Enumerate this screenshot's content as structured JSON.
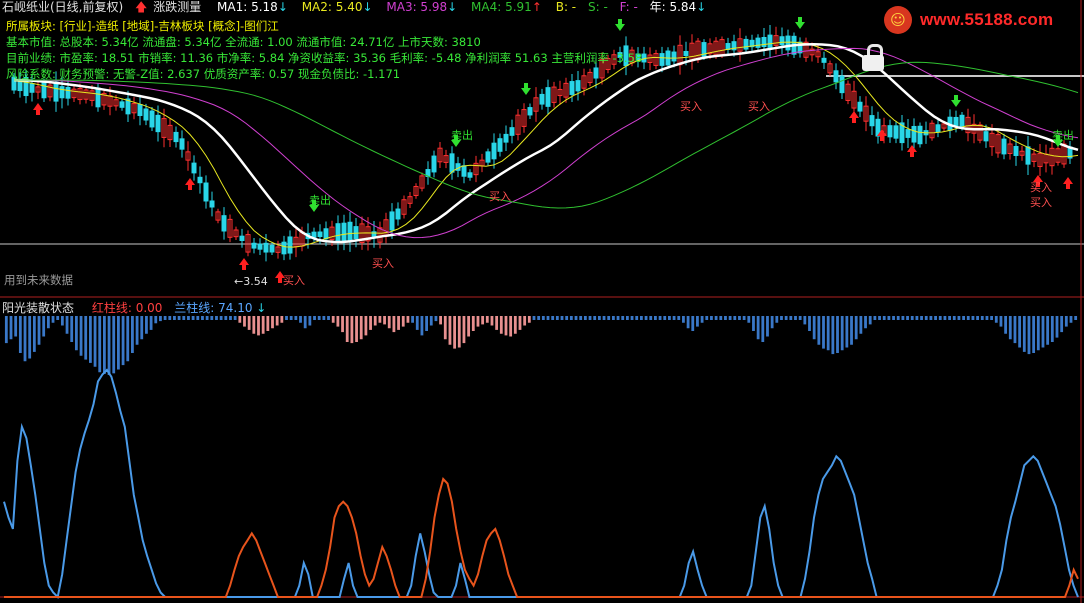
{
  "header": {
    "stock_name": "石岘纸业(日线,前复权)",
    "indicator_icon": "red-up-arrow-icon",
    "indicator_name": "涨跌测量",
    "ma1": "MA1: 5.18",
    "ma2": "MA2: 5.40",
    "ma3": "MA3: 5.98",
    "ma4": "MA4: 5.91",
    "b": "B: -",
    "s": "S: -",
    "f": "F: -",
    "year": "年: 5.84"
  },
  "info_lines": [
    "所属板块: [行业]-造纸 [地域]-吉林板块 [概念]-图们江",
    "基本市值: 总股本: 5.34亿 流通盘: 5.34亿 全流通: 1.00 流通市值: 24.71亿 上市天数: 3810",
    "目前业绩: 市盈率: 18.51 市销率: 11.36 市净率: 5.84 净资收益率: 35.36 毛利率: -5.48 净利润率 51.63 主营利润率 -3.58",
    "风险系数: 财务预警: 无警-Z值: 2.637 优质资产率: 0.57 现金负债比: -1.171"
  ],
  "price_chart": {
    "low_label": "←3.54",
    "future_note": "用到未来数据",
    "marks": [
      "卖出",
      "卖出",
      "卖出",
      "买入",
      "买入",
      "买入",
      "买入",
      "买入",
      "买入",
      "买入"
    ]
  },
  "indicator": {
    "title": "阳光装散状态",
    "red_line": "红柱线: 0.00",
    "blue_line": "兰柱线: 74.10"
  },
  "logo": {
    "url": "www.55188.com"
  },
  "colors": {
    "background": "#000000",
    "up_candle": "#ff3030",
    "down_candle": "#29d6e8",
    "ma_white": "#ffffff",
    "ma_yellow": "#e8e820",
    "ma_magenta": "#d040d0",
    "ma_green": "#30c030",
    "red_line": "#e8541c",
    "blue_line": "#4a9ae8",
    "blue_bar": "#3a78c8",
    "pink_bar": "#e89090"
  },
  "chart_data": {
    "type": "line",
    "title": "阳光装散状态",
    "ylim": [
      0,
      100
    ],
    "series": [
      {
        "name": "兰柱线",
        "values": [
          42,
          35,
          30,
          60,
          75,
          70,
          58,
          45,
          30,
          15,
          5,
          2,
          0,
          10,
          25,
          40,
          55,
          65,
          72,
          78,
          85,
          95,
          98,
          100,
          97,
          90,
          82,
          75,
          60,
          45,
          35,
          25,
          18,
          12,
          6,
          2,
          0,
          0,
          0,
          0,
          0,
          0,
          0,
          0,
          0,
          0,
          0,
          0,
          0,
          0,
          0,
          0,
          0,
          0,
          0,
          0,
          0,
          0,
          0,
          0,
          0,
          0,
          0,
          0,
          0,
          0,
          5,
          15,
          10,
          0,
          0,
          0,
          0,
          0,
          0,
          0,
          8,
          15,
          5,
          0,
          0,
          0,
          0,
          0,
          0,
          0,
          0,
          0,
          0,
          0,
          0,
          5,
          18,
          28,
          20,
          10,
          2,
          0,
          0,
          0,
          0,
          5,
          15,
          8,
          0,
          0,
          0,
          0,
          0,
          0,
          0,
          0,
          0,
          0,
          0,
          0,
          0,
          0,
          0,
          0,
          0,
          0,
          0,
          0,
          0,
          0,
          0,
          0,
          0,
          0,
          0,
          0,
          0,
          0,
          0,
          0,
          0,
          0,
          0,
          0,
          0,
          0,
          0,
          0,
          0,
          0,
          0,
          0,
          0,
          0,
          0,
          0,
          5,
          15,
          20,
          12,
          5,
          0,
          0,
          0,
          0,
          0,
          0,
          0,
          0,
          0,
          0,
          5,
          20,
          35,
          40,
          30,
          15,
          5,
          0,
          0,
          0,
          0,
          0,
          8,
          20,
          35,
          45,
          52,
          55,
          58,
          62,
          60,
          55,
          50,
          45,
          35,
          25,
          15,
          8,
          0,
          0,
          0,
          0,
          0,
          0,
          0,
          0,
          0,
          0,
          0,
          0,
          0,
          0,
          0,
          0,
          0,
          0,
          0,
          0,
          0,
          0,
          0,
          0,
          0,
          0,
          0,
          5,
          12,
          25,
          35,
          42,
          50,
          58,
          60,
          62,
          60,
          55,
          50,
          45,
          40,
          32,
          22,
          12,
          5,
          0
        ]
      },
      {
        "name": "红柱线",
        "values": [
          0,
          0,
          0,
          0,
          0,
          0,
          0,
          0,
          0,
          0,
          0,
          0,
          0,
          0,
          0,
          0,
          0,
          0,
          0,
          0,
          0,
          0,
          0,
          0,
          0,
          0,
          0,
          0,
          0,
          0,
          0,
          0,
          0,
          0,
          0,
          0,
          0,
          0,
          0,
          0,
          0,
          0,
          0,
          0,
          0,
          0,
          0,
          0,
          0,
          0,
          0,
          0,
          5,
          12,
          18,
          22,
          25,
          28,
          25,
          20,
          15,
          10,
          5,
          0,
          0,
          0,
          0,
          0,
          0,
          0,
          0,
          0,
          0,
          5,
          12,
          22,
          35,
          40,
          42,
          40,
          35,
          28,
          18,
          10,
          5,
          8,
          15,
          22,
          18,
          12,
          5,
          0,
          0,
          0,
          0,
          0,
          0,
          8,
          20,
          35,
          45,
          52,
          50,
          42,
          30,
          20,
          12,
          8,
          5,
          10,
          18,
          25,
          28,
          30,
          25,
          18,
          10,
          5,
          0,
          0,
          0,
          0,
          0,
          0,
          0,
          0,
          0,
          0,
          0,
          0,
          0,
          0,
          0,
          0,
          0,
          0,
          0,
          0,
          0,
          0,
          0,
          0,
          0,
          0,
          0,
          0,
          0,
          0,
          0,
          0,
          0,
          0,
          0,
          0,
          0,
          0,
          0,
          0,
          0,
          0,
          0,
          0,
          0,
          0,
          0,
          0,
          0,
          0,
          0,
          0,
          0,
          0,
          0,
          0,
          0,
          0,
          0,
          0,
          0,
          0,
          0,
          0,
          0,
          0,
          0,
          0,
          0,
          0,
          0,
          0,
          0,
          0,
          0,
          0,
          0,
          0,
          0,
          0,
          0,
          0,
          0,
          0,
          0,
          0,
          0,
          0,
          0,
          0,
          0,
          0,
          0,
          0,
          0,
          0,
          0,
          0,
          0,
          0,
          0,
          0,
          0,
          0,
          0,
          0,
          0,
          0,
          0,
          0,
          0,
          0,
          0,
          0,
          0,
          0,
          0,
          0,
          0,
          0,
          0,
          0,
          0,
          0,
          0,
          0,
          0,
          5,
          12,
          8
        ]
      }
    ]
  }
}
